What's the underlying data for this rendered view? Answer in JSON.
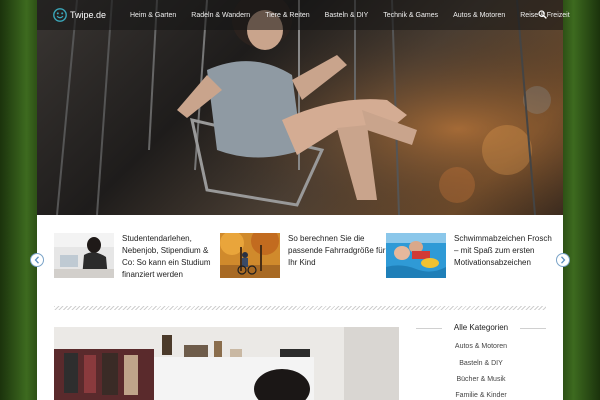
{
  "brand": {
    "name": "Twipe.de"
  },
  "nav": {
    "items": [
      "Heim & Garten",
      "Radeln & Wandern",
      "Tiere & Reiten",
      "Basteln & DIY",
      "Technik & Games",
      "Autos & Motoren",
      "Reise & Freizeit"
    ]
  },
  "teasers": [
    {
      "title": "Studentendarlehen, Nebenjob, Stipendium & Co: So kann ein Studium finanziert werden"
    },
    {
      "title": "So berechnen Sie die passende Fahrradgröße für Ihr Kind"
    },
    {
      "title": "Schwimmabzeichen Frosch – mit Spaß zum ersten Motivationsabzeichen"
    }
  ],
  "sidebar": {
    "title": "Alle Kategorien",
    "categories": [
      "Autos & Motoren",
      "Basteln & DIY",
      "Bücher & Musik",
      "Familie & Kinder"
    ]
  },
  "colors": {
    "accent": "#3aa6b9",
    "background_green": "#3d6a1f",
    "nav_bar": "#141414"
  }
}
